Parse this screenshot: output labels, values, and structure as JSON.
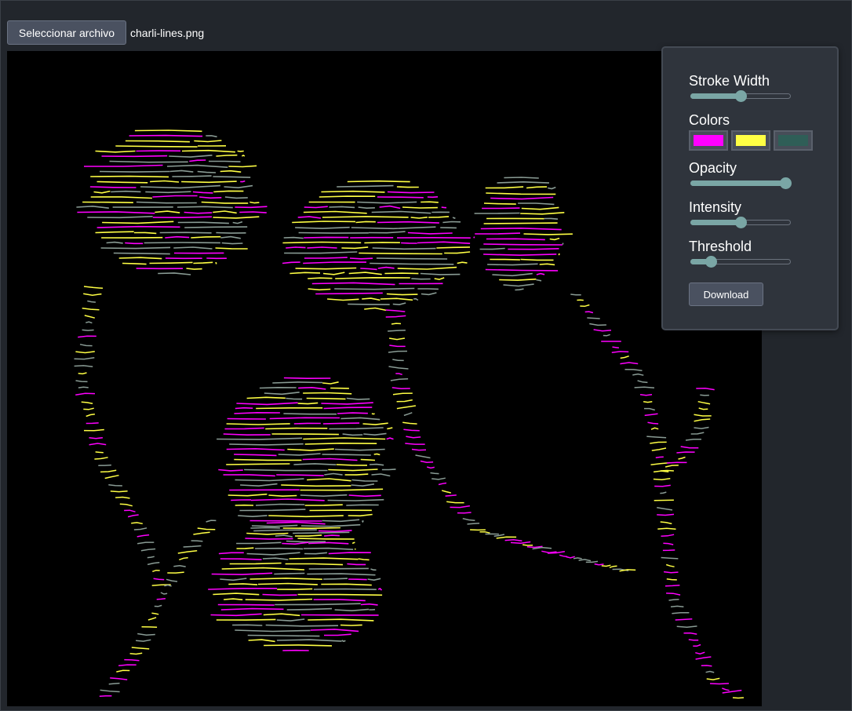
{
  "file_picker": {
    "button_label": "Seleccionar archivo",
    "file_name": "charli-lines.png"
  },
  "canvas": {
    "background": "#000000",
    "content": "horizontal line-art rendering of flowers"
  },
  "controls": {
    "stroke_width": {
      "label": "Stroke Width",
      "value": 0.5
    },
    "colors": {
      "label": "Colors",
      "swatches": [
        "#ff00ff",
        "#ffff44",
        "#2f5e57"
      ]
    },
    "opacity": {
      "label": "Opacity",
      "value": 1.0
    },
    "intensity": {
      "label": "Intensity",
      "value": 0.5
    },
    "threshold": {
      "label": "Threshold",
      "value": 0.17
    },
    "download_label": "Download"
  },
  "theme": {
    "slider_accent": "#7aa6a5",
    "panel_background": "#2f343c",
    "page_background": "#22262c"
  }
}
